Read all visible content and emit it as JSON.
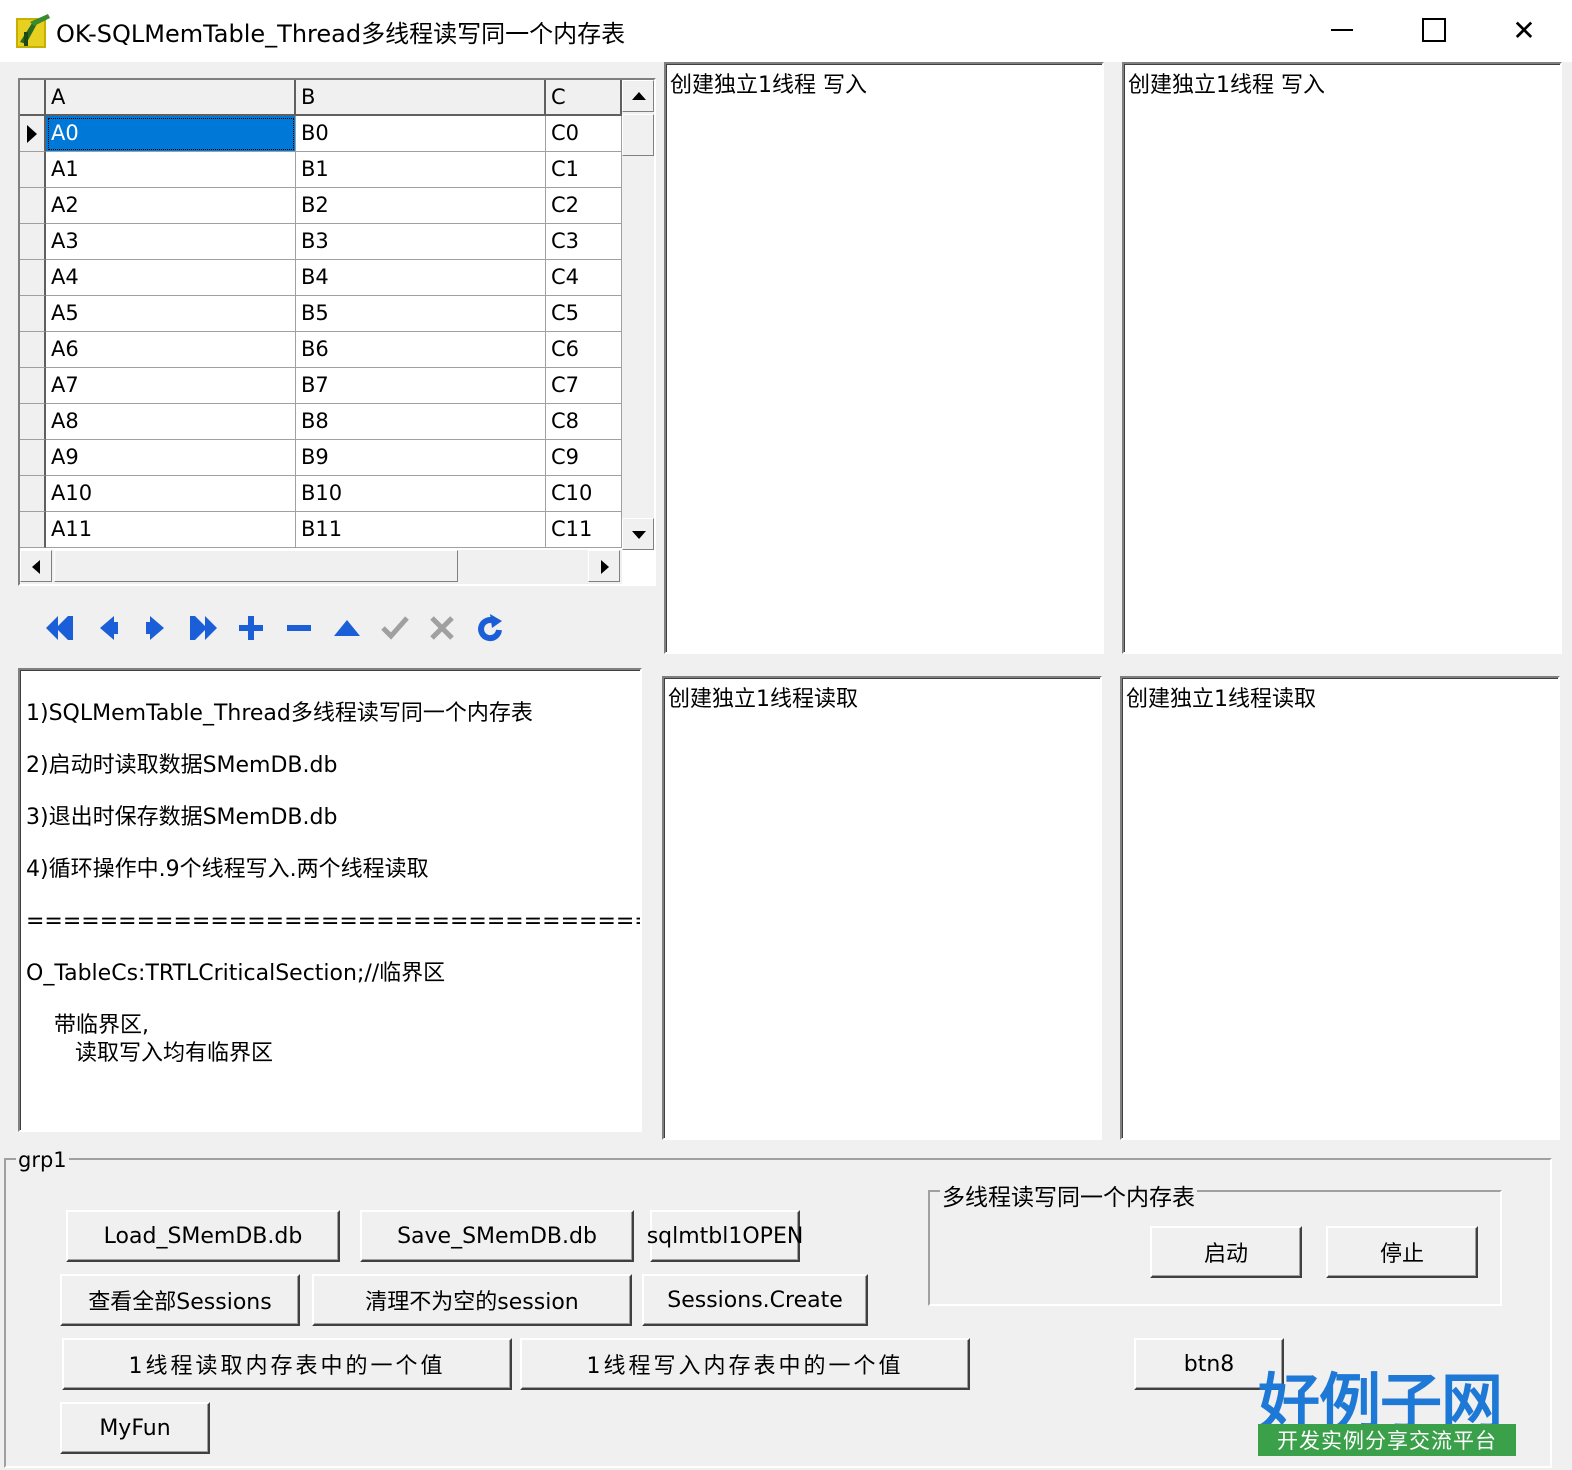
{
  "window": {
    "title": "OK-SQLMemTable_Thread多线程读写同一个内存表",
    "close_glyph": "✕"
  },
  "grid": {
    "columns": [
      "A",
      "B",
      "C"
    ],
    "rows": [
      [
        "A0",
        "B0",
        "C0"
      ],
      [
        "A1",
        "B1",
        "C1"
      ],
      [
        "A2",
        "B2",
        "C2"
      ],
      [
        "A3",
        "B3",
        "C3"
      ],
      [
        "A4",
        "B4",
        "C4"
      ],
      [
        "A5",
        "B5",
        "C5"
      ],
      [
        "A6",
        "B6",
        "C6"
      ],
      [
        "A7",
        "B7",
        "C7"
      ],
      [
        "A8",
        "B8",
        "C8"
      ],
      [
        "A9",
        "B9",
        "C9"
      ],
      [
        "A10",
        "B10",
        "C10"
      ],
      [
        "A11",
        "B11",
        "C11"
      ]
    ],
    "selected_row": 0
  },
  "navigator": {
    "buttons": [
      "first-icon",
      "prior-icon",
      "next-icon",
      "last-icon",
      "insert-icon",
      "delete-icon",
      "edit-icon",
      "post-icon",
      "cancel-icon",
      "refresh-icon"
    ],
    "color": "#1a5ed8",
    "disabled_color": "#a0a0a0"
  },
  "memos": {
    "write1": "创建独立1线程 写入",
    "write2": "创建独立1线程 写入",
    "read1": "创建独立1线程读取",
    "read2": "创建独立1线程读取"
  },
  "info": {
    "lines": [
      "1)SQLMemTable_Thread多线程读写同一个内存表",
      "2)启动时读取数据SMemDB.db",
      "3)退出时保存数据SMemDB.db",
      "4)循环操作中.9个线程写入.两个线程读取",
      "====================================",
      "O_TableCs:TRTLCriticalSection;//临界区",
      "    带临界区,",
      "       读取写入均有临界区"
    ]
  },
  "group": {
    "caption": "grp1",
    "buttons": {
      "load": "Load_SMemDB.db",
      "save": "Save_SMemDB.db",
      "open": "sqlmtbl1OPEN",
      "view_sessions": "查看全部Sessions",
      "clean_session": "清理不为空的session",
      "sessions_create": "Sessions.Create",
      "read_one": "1线程读取内存表中的一个值",
      "write_one": "1线程写入内存表中的一个值",
      "btn8": "btn8",
      "myfun": "MyFun"
    },
    "threads": {
      "caption": "多线程读写同一个内存表",
      "start": "启动",
      "stop": "停止"
    }
  },
  "logo": {
    "main": "好例子网",
    "sub": "开发实例分享交流平台",
    "main_color": "#1e78d6",
    "sub_color": "#3aa04a"
  }
}
